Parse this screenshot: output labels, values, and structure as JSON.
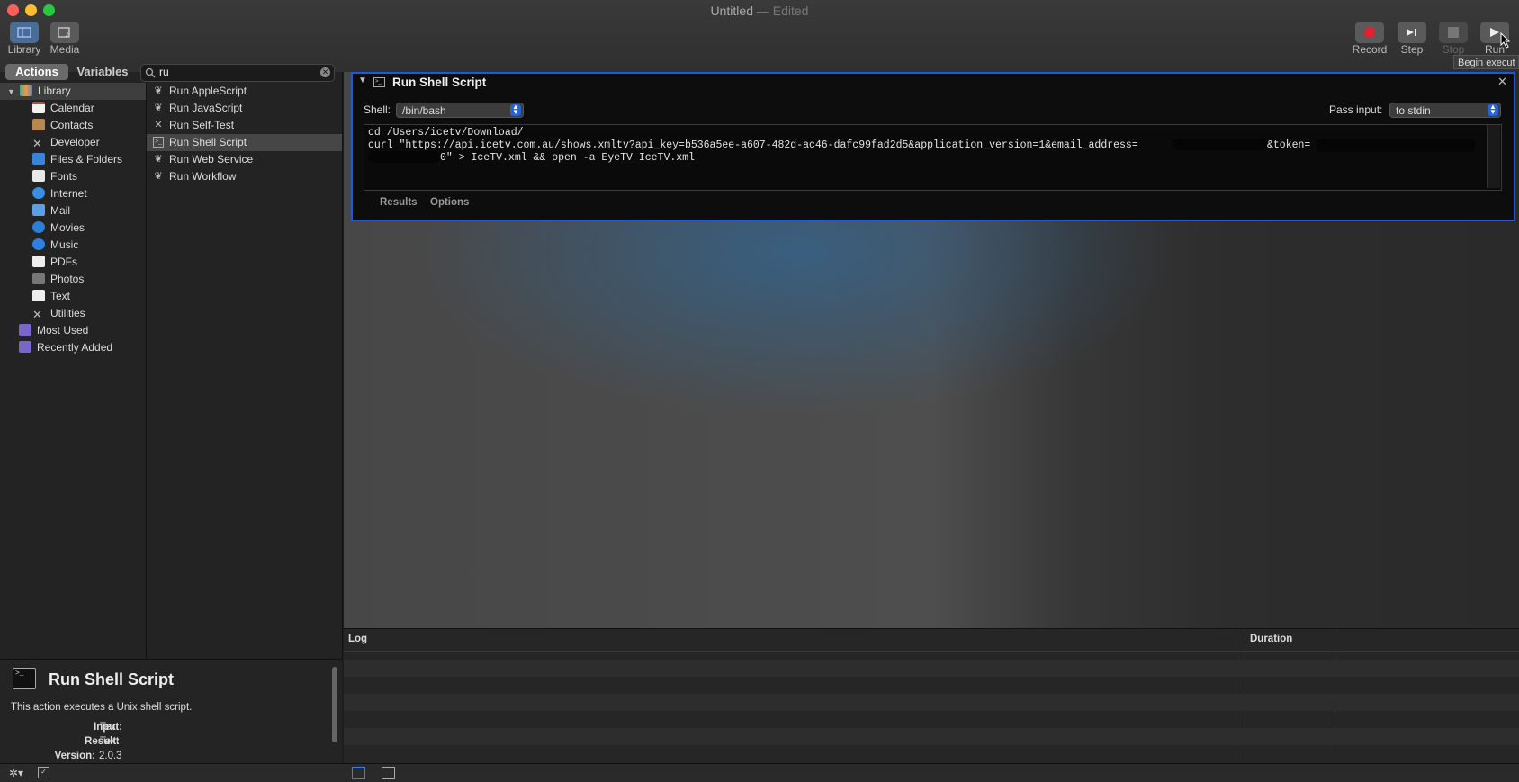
{
  "window": {
    "title": "Untitled",
    "edited": " — Edited"
  },
  "toolbar": {
    "library_label": "Library",
    "media_label": "Media",
    "record_label": "Record",
    "step_label": "Step",
    "stop_label": "Stop",
    "run_label": "Run",
    "tooltip": "Begin execut"
  },
  "left_tabs": {
    "actions": "Actions",
    "variables": "Variables"
  },
  "search": {
    "value": "ru"
  },
  "library": {
    "root": "Library",
    "items": [
      "Calendar",
      "Contacts",
      "Developer",
      "Files & Folders",
      "Fonts",
      "Internet",
      "Mail",
      "Movies",
      "Music",
      "PDFs",
      "Photos",
      "Text",
      "Utilities"
    ],
    "most_used": "Most Used",
    "recently_added": "Recently Added"
  },
  "actions": [
    "Run AppleScript",
    "Run JavaScript",
    "Run Self-Test",
    "Run Shell Script",
    "Run Web Service",
    "Run Workflow"
  ],
  "description": {
    "title": "Run Shell Script",
    "text": "This action executes a Unix shell script.",
    "input_label": "Input:",
    "input_value": "Text",
    "result_label": "Result:",
    "result_value": "Text",
    "version_label": "Version:",
    "version_value": "2.0.3"
  },
  "action_card": {
    "title": "Run Shell Script",
    "shell_label": "Shell:",
    "shell_value": "/bin/bash",
    "pass_input_label": "Pass input:",
    "pass_input_value": "to stdin",
    "script_line1": "cd /Users/icetv/Download/",
    "script_line2a": "curl \"https://api.icetv.com.au/shows.xmltv?api_key=b536a5ee-a607-482d-ac46-dafc99fad2d5&application_version=1&email_address=",
    "script_line2b": "&token=",
    "script_line3": "0\" > IceTV.xml && open -a EyeTV IceTV.xml",
    "results_tab": "Results",
    "options_tab": "Options"
  },
  "log": {
    "log_header": "Log",
    "duration_header": "Duration"
  }
}
